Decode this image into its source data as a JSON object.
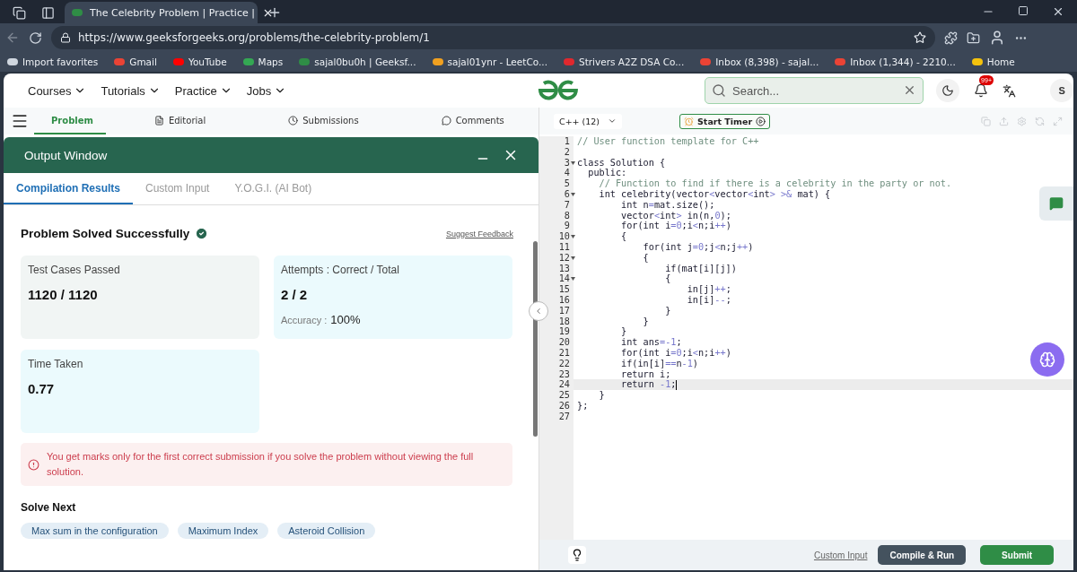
{
  "browser": {
    "tabs": [
      {
        "title": "The Celebrity Problem | Practice |",
        "selected": true
      }
    ],
    "url": "https://www.geeksforgeeks.org/problems/the-celebrity-problem/1",
    "bookmarks": [
      {
        "label": "Import favorites",
        "color": "#cfd6df"
      },
      {
        "label": "Gmail",
        "color": "#ea4335"
      },
      {
        "label": "YouTube",
        "color": "#ff0000"
      },
      {
        "label": "Maps",
        "color": "#34a853"
      },
      {
        "label": "sajal0bu0h | Geeksf...",
        "color": "#2f8d46"
      },
      {
        "label": "sajal01ynr - LeetCo...",
        "color": "#f0a020"
      },
      {
        "label": "Strivers A2Z DSA Co...",
        "color": "#e0282e"
      },
      {
        "label": "Inbox (8,398) - sajal...",
        "color": "#ea4335"
      },
      {
        "label": "Inbox (1,344) - 2210...",
        "color": "#ea4335"
      },
      {
        "label": "Home",
        "color": "#f4c20d"
      }
    ]
  },
  "site": {
    "nav": [
      "Courses",
      "Tutorials",
      "Practice",
      "Jobs"
    ],
    "search": {
      "placeholder": "Search..."
    },
    "notifications": "99+",
    "avatar": "S"
  },
  "problem_tabs": [
    {
      "label": "Problem",
      "selected": true
    },
    {
      "label": "Editorial",
      "selected": false
    },
    {
      "label": "Submissions",
      "selected": false
    },
    {
      "label": "Comments",
      "selected": false
    }
  ],
  "output_window": {
    "title": "Output Window",
    "tabs": [
      {
        "label": "Compilation Results",
        "selected": true
      },
      {
        "label": "Custom Input",
        "selected": false
      },
      {
        "label": "Y.O.G.I. (AI Bot)",
        "selected": false
      }
    ],
    "status": "Problem Solved Successfully",
    "feedback_link": "Suggest Feedback",
    "cards": [
      {
        "label": "Test Cases Passed",
        "value": "1120 / 1120",
        "color": "#f1f5f4"
      },
      {
        "label": "Attempts : Correct / Total",
        "value": "2 / 2",
        "extra_label": "Accuracy :",
        "extra_value": "100%",
        "color": "#ebfafd"
      },
      {
        "label": "Time Taken",
        "value": "0.77",
        "color": "#ebfafd"
      }
    ],
    "notice": "You get marks only for the first correct submission if you solve the problem without viewing the full solution.",
    "solve_next": {
      "title": "Solve Next",
      "items": [
        "Max sum in the configuration",
        "Maximum Index",
        "Asteroid Collision"
      ]
    }
  },
  "editor": {
    "language": "C++ (12)",
    "timer_button": "Start Timer",
    "lines": [
      {
        "number": "1",
        "text": "// User function template for C++",
        "kind": "comment",
        "foldable": false,
        "current": false
      },
      {
        "number": "2",
        "foldable": false,
        "current": false
      },
      {
        "number": "3",
        "text": "class Solution {",
        "kind": "code",
        "foldable": true,
        "current": false
      },
      {
        "number": "4",
        "text": "  public:",
        "kind": "code",
        "foldable": false,
        "current": false
      },
      {
        "number": "5",
        "text": "    // Function to find if there is a celebrity in the party or not.",
        "kind": "comment",
        "foldable": false,
        "current": false
      },
      {
        "number": "6",
        "text": "    int celebrity(vector<vector<int> >& mat) {",
        "kind": "code",
        "foldable": true,
        "current": false
      },
      {
        "number": "7",
        "text": "        int n=mat.size();",
        "kind": "code",
        "foldable": false,
        "current": false
      },
      {
        "number": "8",
        "text": "        vector<int> in(n,0);",
        "kind": "code",
        "foldable": false,
        "current": false
      },
      {
        "number": "9",
        "text": "        for(int i=0;i<n;i++)",
        "kind": "code",
        "foldable": false,
        "current": false
      },
      {
        "number": "10",
        "text": "        {",
        "kind": "code",
        "foldable": true,
        "current": false
      },
      {
        "number": "11",
        "text": "            for(int j=0;j<n;j++)",
        "kind": "code",
        "foldable": false,
        "current": false
      },
      {
        "number": "12",
        "text": "            {",
        "kind": "code",
        "foldable": true,
        "current": false
      },
      {
        "number": "13",
        "text": "                if(mat[i][j])",
        "kind": "code",
        "foldable": false,
        "current": false
      },
      {
        "number": "14",
        "text": "                {",
        "kind": "code",
        "foldable": true,
        "current": false
      },
      {
        "number": "15",
        "text": "                    in[j]++;",
        "kind": "code",
        "foldable": false,
        "current": false
      },
      {
        "number": "16",
        "text": "                    in[i]--;",
        "kind": "code",
        "foldable": false,
        "current": false
      },
      {
        "number": "17",
        "text": "                }",
        "kind": "code",
        "foldable": false,
        "current": false
      },
      {
        "number": "18",
        "text": "            }",
        "kind": "code",
        "foldable": false,
        "current": false
      },
      {
        "number": "19",
        "text": "        }",
        "kind": "code",
        "foldable": false,
        "current": false
      },
      {
        "number": "20",
        "text": "        int ans=-1;",
        "kind": "code",
        "foldable": false,
        "current": false
      },
      {
        "number": "21",
        "text": "        for(int i=0;i<n;i++)",
        "kind": "code",
        "foldable": false,
        "current": false
      },
      {
        "number": "22",
        "text": "        if(in[i]==n-1)",
        "kind": "code",
        "foldable": false,
        "current": false
      },
      {
        "number": "23",
        "text": "        return i;",
        "kind": "code",
        "foldable": false,
        "current": false
      },
      {
        "number": "24",
        "text": "        return -1;",
        "kind": "code",
        "foldable": false,
        "current": true
      },
      {
        "number": "25",
        "text": "    }",
        "kind": "code",
        "foldable": false,
        "current": false
      },
      {
        "number": "26",
        "text": "};",
        "kind": "code",
        "foldable": false,
        "current": false
      },
      {
        "number": "27",
        "foldable": false,
        "current": false
      }
    ],
    "custom_input_link": "Custom Input",
    "compile_button": "Compile & Run",
    "submit_button": "Submit"
  }
}
